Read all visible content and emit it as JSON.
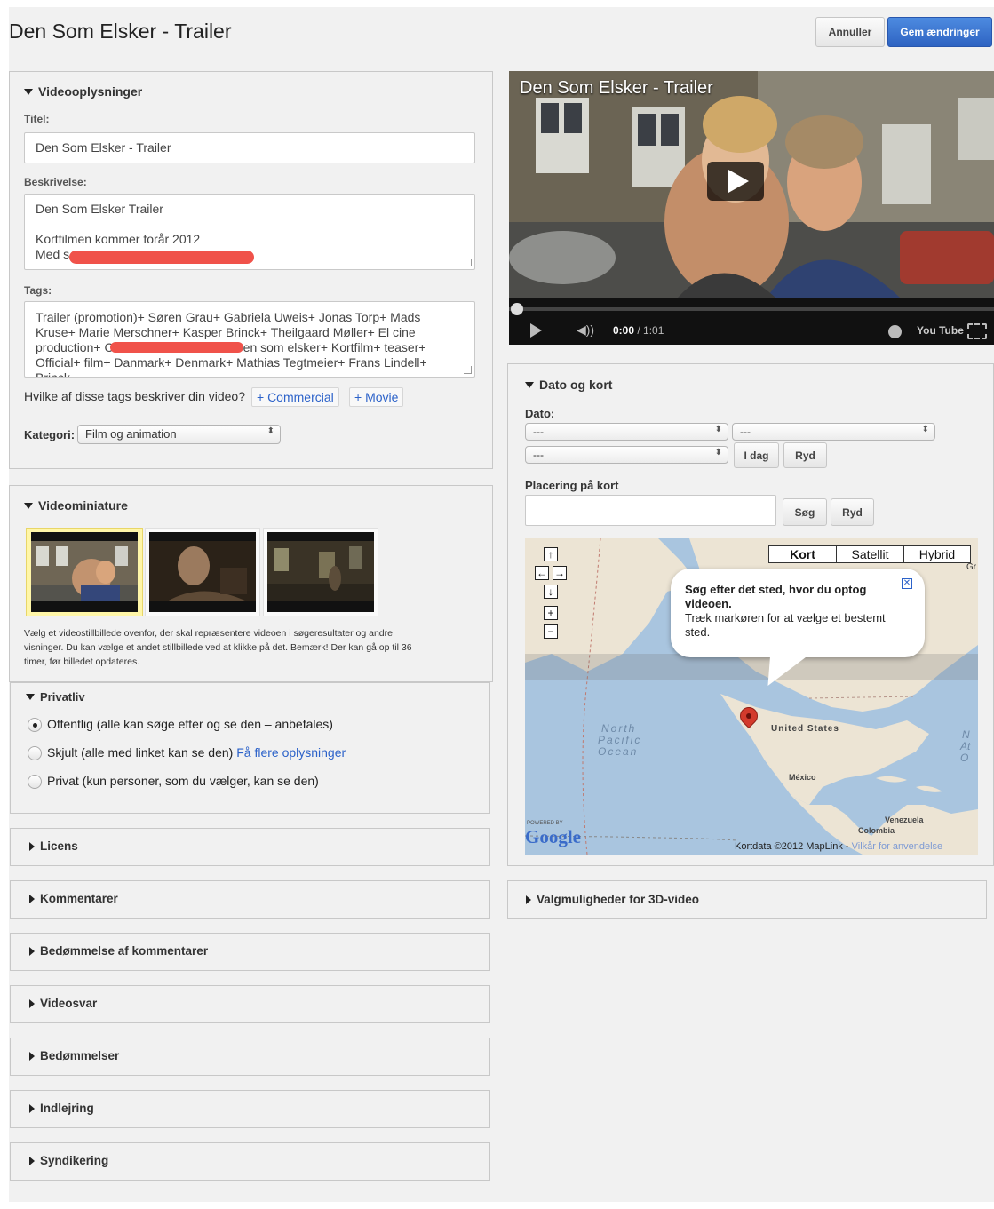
{
  "header": {
    "title": "Den Som Elsker - Trailer",
    "cancel_label": "Annuller",
    "save_label": "Gem ændringer"
  },
  "info": {
    "section_title": "Videooplysninger",
    "title_label": "Titel:",
    "title_value": "Den Som Elsker - Trailer",
    "description_label": "Beskrivelse:",
    "description_line1": "Den Som Elsker Trailer",
    "description_line2": "Kortfilmen kommer forår 2012",
    "description_line3": "Med s",
    "tags_label": "Tags:",
    "tags_line1": "Trailer (promotion)+ Søren Grau+ Gabriela Uweis+ Jonas Torp+ Mads",
    "tags_line2": "Kruse+ Marie Merschner+ Kasper Brinck+ Theilgaard Møller+ El cine",
    "tags_line3a": "production+ C",
    "tags_line3b": "Den som elsker+ Kortfilm+ teaser+",
    "tags_line4": "Official+ film+ Danmark+ Denmark+ Mathias Tegtmeier+ Frans Lindell+",
    "tags_line5": "Brinck",
    "tag_question": "Hvilke af disse tags beskriver din video?",
    "tag_suggestion_1": "+ Commercial",
    "tag_suggestion_2": "+ Movie",
    "category_label": "Kategori:",
    "category_value": "Film og animation"
  },
  "thumbnails": {
    "section_title": "Videominiature",
    "help_line1": "Vælg et videostillbillede ovenfor, der skal repræsentere videoen i søgeresultater og andre",
    "help_line2": "visninger. Du kan vælge et andet stillbillede ved at klikke på det. Bemærk! Der kan gå op til 36",
    "help_line3": "timer, før billedet opdateres."
  },
  "privacy": {
    "section_title": "Privatliv",
    "option_public": "Offentlig (alle kan søge efter og se den – anbefales)",
    "option_unlisted": "Skjult (alle med linket kan se den)",
    "option_unlisted_link": "Få flere oplysninger",
    "option_private": "Privat (kun personer, som du vælger, kan se den)",
    "selected": "public"
  },
  "collapsed_sections": {
    "license": "Licens",
    "comments": "Kommentarer",
    "comment_rating": "Bedømmelse af kommentarer",
    "video_responses": "Videosvar",
    "ratings": "Bedømmelser",
    "embedding": "Indlejring",
    "syndication": "Syndikering",
    "options_3d": "Valgmuligheder for 3D-video"
  },
  "player": {
    "title": "Den Som Elsker - Trailer",
    "time": "0:00",
    "duration": "/ 1:01",
    "logo": "You Tube",
    "progress": 0
  },
  "date_map": {
    "section_title": "Dato og kort",
    "date_label": "Dato:",
    "date_select_1": "---",
    "date_select_2": "---",
    "date_select_3": "---",
    "today_label": "I dag",
    "clear_label": "Ryd",
    "location_label": "Placering på kort",
    "location_placeholder": "",
    "search_label": "Søg",
    "clear_location_label": "Ryd"
  },
  "map": {
    "type_map": "Kort",
    "type_satellite": "Satellit",
    "type_hybrid": "Hybrid",
    "edge_label": "Gr",
    "popup_bold_line1": "Søg efter det sted, hvor du optog",
    "popup_bold_line2": "videoen.",
    "popup_line3": "Træk markøren for at vælge et bestemt",
    "popup_line4": "sted.",
    "ocean_line1": "North",
    "ocean_line2": "Pacific",
    "ocean_line3": "Ocean",
    "label_us": "United States",
    "label_mexico": "México",
    "label_venezuela": "Venezuela",
    "label_colombia": "Colombia",
    "label_atl1": "N",
    "label_atl2": "At",
    "label_atl3": "O",
    "powered_by": "POWERED BY",
    "google": "Google",
    "attribution": "Kortdata ©2012 MapLink -",
    "terms_link": "Vilkår for anvendelse"
  }
}
